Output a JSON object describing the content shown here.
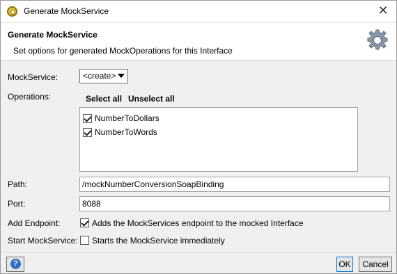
{
  "window": {
    "title": "Generate MockService",
    "close_glyph": "✕"
  },
  "header": {
    "title": "Generate MockService",
    "subtitle": "Set options for generated MockOperations for this Interface",
    "icon": "gear-icon"
  },
  "form": {
    "mockservice_label": "MockService:",
    "mockservice_value": "<create>",
    "operations_label": "Operations:",
    "select_all": "Select all",
    "unselect_all": "Unselect all",
    "operations": [
      {
        "label": "NumberToDollars",
        "checked": true
      },
      {
        "label": "NumberToWords",
        "checked": true
      }
    ],
    "path_label": "Path:",
    "path_value": "/mockNumberConversionSoapBinding",
    "port_label": "Port:",
    "port_value": "8088",
    "add_endpoint_label": "Add Endpoint:",
    "add_endpoint_text": "Adds the MockServices endpoint to the mocked Interface",
    "add_endpoint_checked": true,
    "start_label": "Start MockService:",
    "start_text": "Starts the MockService immediately",
    "start_checked": false
  },
  "buttons": {
    "help": "?",
    "ok": "OK",
    "cancel": "Cancel"
  },
  "colors": {
    "ok_border": "#0078d7",
    "help_icon": "#2f6fc4",
    "app_icon": "#e8c23a"
  }
}
